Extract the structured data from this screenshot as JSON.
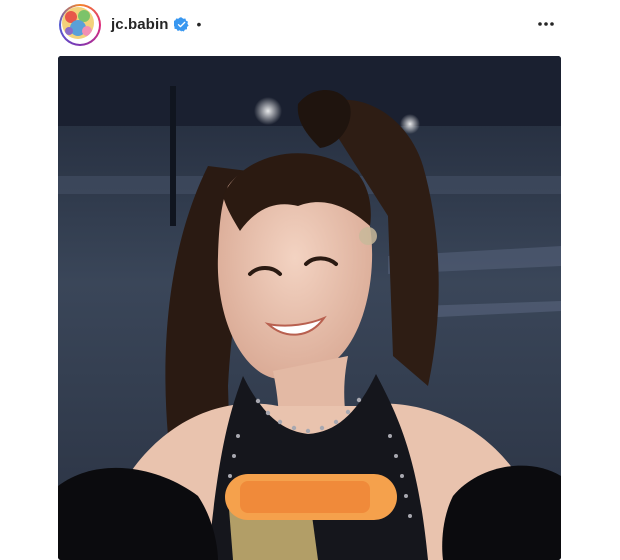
{
  "post": {
    "username": "jc.babin",
    "separator": "•",
    "verified": true,
    "header_icons": {
      "avatar": "profile-avatar",
      "verified": "verified-badge-icon",
      "more": "more-options-icon"
    },
    "colors": {
      "verified_badge": "#3897f0",
      "text": "#262626",
      "redaction": "#f5a14c"
    }
  }
}
